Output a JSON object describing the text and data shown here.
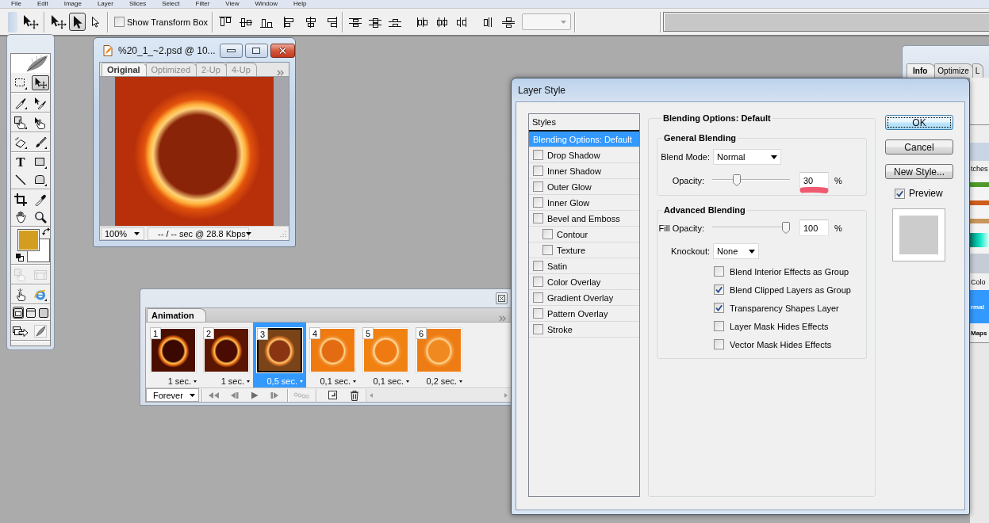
{
  "menu_bar": {
    "items": [
      "File",
      "Edit",
      "Image",
      "Layer",
      "Slices",
      "Select",
      "Filter",
      "View",
      "Window",
      "Help"
    ]
  },
  "options_bar": {
    "tool_modes": [
      {
        "selected": false
      },
      {
        "selected": true
      },
      {
        "selected": false
      }
    ],
    "show_transform_box": {
      "label": "Show Transform Box",
      "checked": false
    },
    "dropdown": {
      "disabled": true
    }
  },
  "toolbox": {
    "tools": [
      {
        "selected": false,
        "disabled": false
      },
      {
        "selected": true,
        "disabled": false
      },
      {
        "selected": false,
        "disabled": false
      },
      {
        "selected": false,
        "disabled": false
      },
      {
        "selected": false,
        "disabled": false
      },
      {
        "selected": false,
        "disabled": false
      },
      {
        "selected": false,
        "disabled": false
      },
      {
        "selected": false,
        "disabled": false
      },
      {
        "selected": false,
        "disabled": false,
        "glyph": "T"
      },
      {
        "selected": false,
        "disabled": false
      },
      {
        "selected": false,
        "disabled": false
      },
      {
        "selected": false,
        "disabled": false
      },
      {
        "selected": false,
        "disabled": false
      },
      {
        "selected": false,
        "disabled": false
      },
      {
        "selected": false,
        "disabled": false
      },
      {
        "selected": false,
        "disabled": false
      },
      {
        "selected": false,
        "disabled": true
      },
      {
        "selected": false,
        "disabled": true
      },
      {
        "selected": false,
        "disabled": false
      },
      {
        "selected": false,
        "disabled": false
      },
      {
        "selected": true,
        "disabled": false
      },
      {
        "selected": false,
        "disabled": false
      },
      {
        "selected": false,
        "disabled": false
      },
      {
        "selected": false,
        "disabled": false
      },
      {
        "selected": false,
        "disabled": false
      }
    ],
    "colors": [
      {
        "kind": "foreground",
        "color": "#d39e1f"
      },
      {
        "kind": "background",
        "color": "#ffffff"
      }
    ]
  },
  "document_window": {
    "title": "%20_1_~2.psd @ 10...",
    "tabs": [
      {
        "label": "Original",
        "selected": true
      },
      {
        "label": "Optimized",
        "selected": false
      },
      {
        "label": "2-Up",
        "selected": false
      },
      {
        "label": "4-Up",
        "selected": false
      }
    ],
    "zoom": "100%",
    "download_time": "-- / -- sec @ 28.8 Kbps"
  },
  "animation_palette": {
    "tab": "Animation",
    "frames": [
      {
        "number": "1",
        "delay": "1 sec.",
        "selected": false
      },
      {
        "number": "2",
        "delay": "1 sec.",
        "selected": false
      },
      {
        "number": "3",
        "delay": "0,5 sec.",
        "selected": true
      },
      {
        "number": "4",
        "delay": "0,1 sec.",
        "selected": false
      },
      {
        "number": "5",
        "delay": "0,1 sec.",
        "selected": false
      },
      {
        "number": "6",
        "delay": "0,2 sec.",
        "selected": false
      }
    ],
    "loop": "Forever"
  },
  "side_palettes": {
    "tabs": [
      {
        "label": "Info",
        "selected": true
      },
      {
        "label": "Optimize",
        "selected": false
      },
      {
        "label": "L",
        "selected": false
      }
    ],
    "swatches_tab": "tches",
    "swatches": [
      {
        "color": "#4f9a2b"
      },
      {
        "color": "#cf5c1c"
      },
      {
        "color": "#c9955c"
      }
    ],
    "color_tab": "Colo",
    "blend_mode": "rmal",
    "layer_row": "Maps"
  },
  "layer_style": {
    "title": "Layer Style",
    "styles_header": "Styles",
    "styles": [
      {
        "label": "Blending Options: Default",
        "kind": "option",
        "selected": true
      },
      {
        "label": "Drop Shadow",
        "kind": "effect",
        "checked": false,
        "selected": false
      },
      {
        "label": "Inner Shadow",
        "kind": "effect",
        "checked": false,
        "selected": false
      },
      {
        "label": "Outer Glow",
        "kind": "effect",
        "checked": false,
        "selected": false
      },
      {
        "label": "Inner Glow",
        "kind": "effect",
        "checked": false,
        "selected": false
      },
      {
        "label": "Bevel and Emboss",
        "kind": "effect",
        "checked": false,
        "selected": false,
        "children": [
          {
            "label": "Contour",
            "kind": "effect",
            "checked": false,
            "selected": false
          },
          {
            "label": "Texture",
            "kind": "effect",
            "checked": false,
            "selected": false
          }
        ]
      },
      {
        "label": "Satin",
        "kind": "effect",
        "checked": false,
        "selected": false
      },
      {
        "label": "Color Overlay",
        "kind": "effect",
        "checked": false,
        "selected": false
      },
      {
        "label": "Gradient Overlay",
        "kind": "effect",
        "checked": false,
        "selected": false
      },
      {
        "label": "Pattern Overlay",
        "kind": "effect",
        "checked": false,
        "selected": false
      },
      {
        "label": "Stroke",
        "kind": "effect",
        "checked": false,
        "selected": false
      }
    ],
    "blending": {
      "title": "Blending Options: Default",
      "general": {
        "title": "General Blending",
        "blend_mode": {
          "label": "Blend Mode:",
          "value": "Normal"
        },
        "opacity": {
          "label": "Opacity:",
          "level": 0.3,
          "value": "30",
          "unit": "%",
          "highlighted": true
        }
      },
      "advanced": {
        "title": "Advanced Blending",
        "fill_opacity": {
          "label": "Fill Opacity:",
          "level": 1,
          "value": "100",
          "unit": "%"
        },
        "knockout": {
          "label": "Knockout:",
          "value": "None"
        },
        "options": [
          {
            "label": "Blend Interior Effects as Group",
            "checked": false
          },
          {
            "label": "Blend Clipped Layers as Group",
            "checked": true
          },
          {
            "label": "Transparency Shapes Layer",
            "checked": true
          },
          {
            "label": "Layer Mask Hides Effects",
            "checked": false
          },
          {
            "label": "Vector Mask Hides Effects",
            "checked": false
          }
        ]
      }
    },
    "buttons": [
      {
        "label": "OK",
        "kind": "default"
      },
      {
        "label": "Cancel",
        "kind": "normal"
      },
      {
        "label": "New Style...",
        "kind": "normal"
      }
    ],
    "preview": {
      "label": "Preview",
      "checked": true
    }
  }
}
